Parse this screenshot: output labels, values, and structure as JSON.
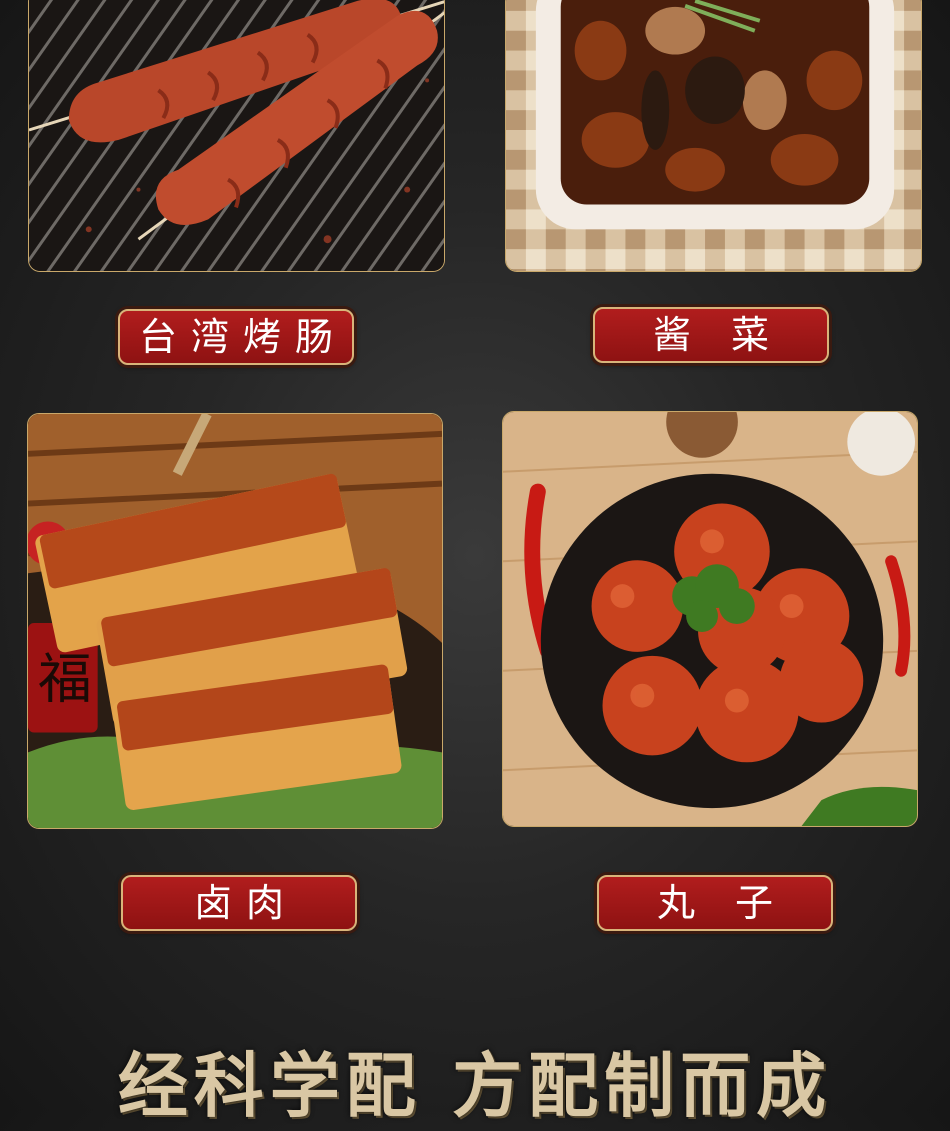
{
  "items": [
    {
      "label": "台湾烤肠"
    },
    {
      "label": "酱 菜"
    },
    {
      "label": "卤肉"
    },
    {
      "label": "丸 子"
    }
  ],
  "slogan": "经科学配 方配制而成",
  "colors": {
    "label_red": "#a01717",
    "label_border": "#d8b47a",
    "tile_border": "#c9a86a",
    "slogan": "#d9c7a4"
  }
}
